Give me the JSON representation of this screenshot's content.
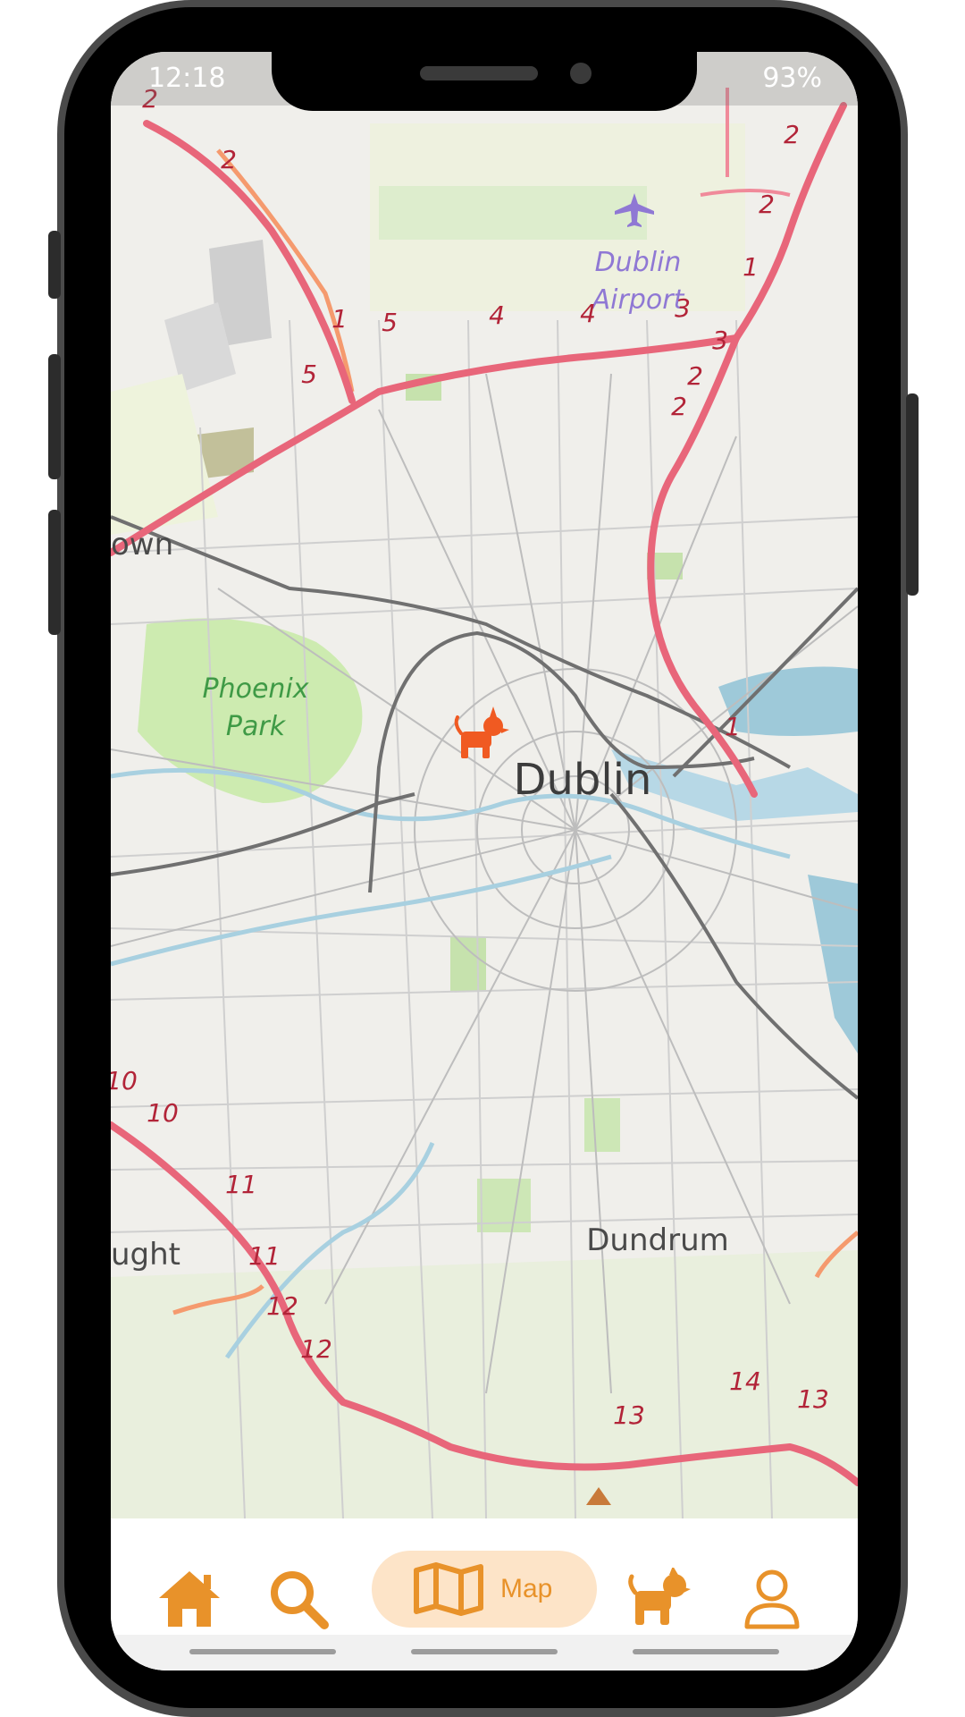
{
  "status_bar": {
    "time": "12:18",
    "battery": "93%"
  },
  "map": {
    "labels": {
      "airport": [
        "Dublin",
        "Airport"
      ],
      "city": "Dublin",
      "park": [
        "Phoenix",
        "Park"
      ],
      "dundrum": "Dundrum",
      "left_top": "own",
      "left_bottom": "ught"
    },
    "route_numbers": [
      "2",
      "2",
      "2",
      "2",
      "1",
      "5",
      "4",
      "4",
      "3",
      "3",
      "2",
      "2",
      "1",
      "5",
      "1",
      "10",
      "10",
      "11",
      "11",
      "12",
      "12",
      "13",
      "14",
      "13"
    ]
  },
  "bottom_nav": {
    "items": [
      {
        "icon": "home-icon"
      },
      {
        "icon": "search-icon"
      },
      {
        "icon": "map-icon",
        "label": "Map"
      },
      {
        "icon": "dog-icon"
      },
      {
        "icon": "profile-icon"
      }
    ],
    "accent": "#e8922a",
    "active_pill": "#fde4c8"
  },
  "colors": {
    "motorway": "#e8667a",
    "primary_road": "#f59a6e",
    "park": "#cdebb0",
    "water": "#9ec9d9",
    "dog_marker": "#f05a22"
  }
}
